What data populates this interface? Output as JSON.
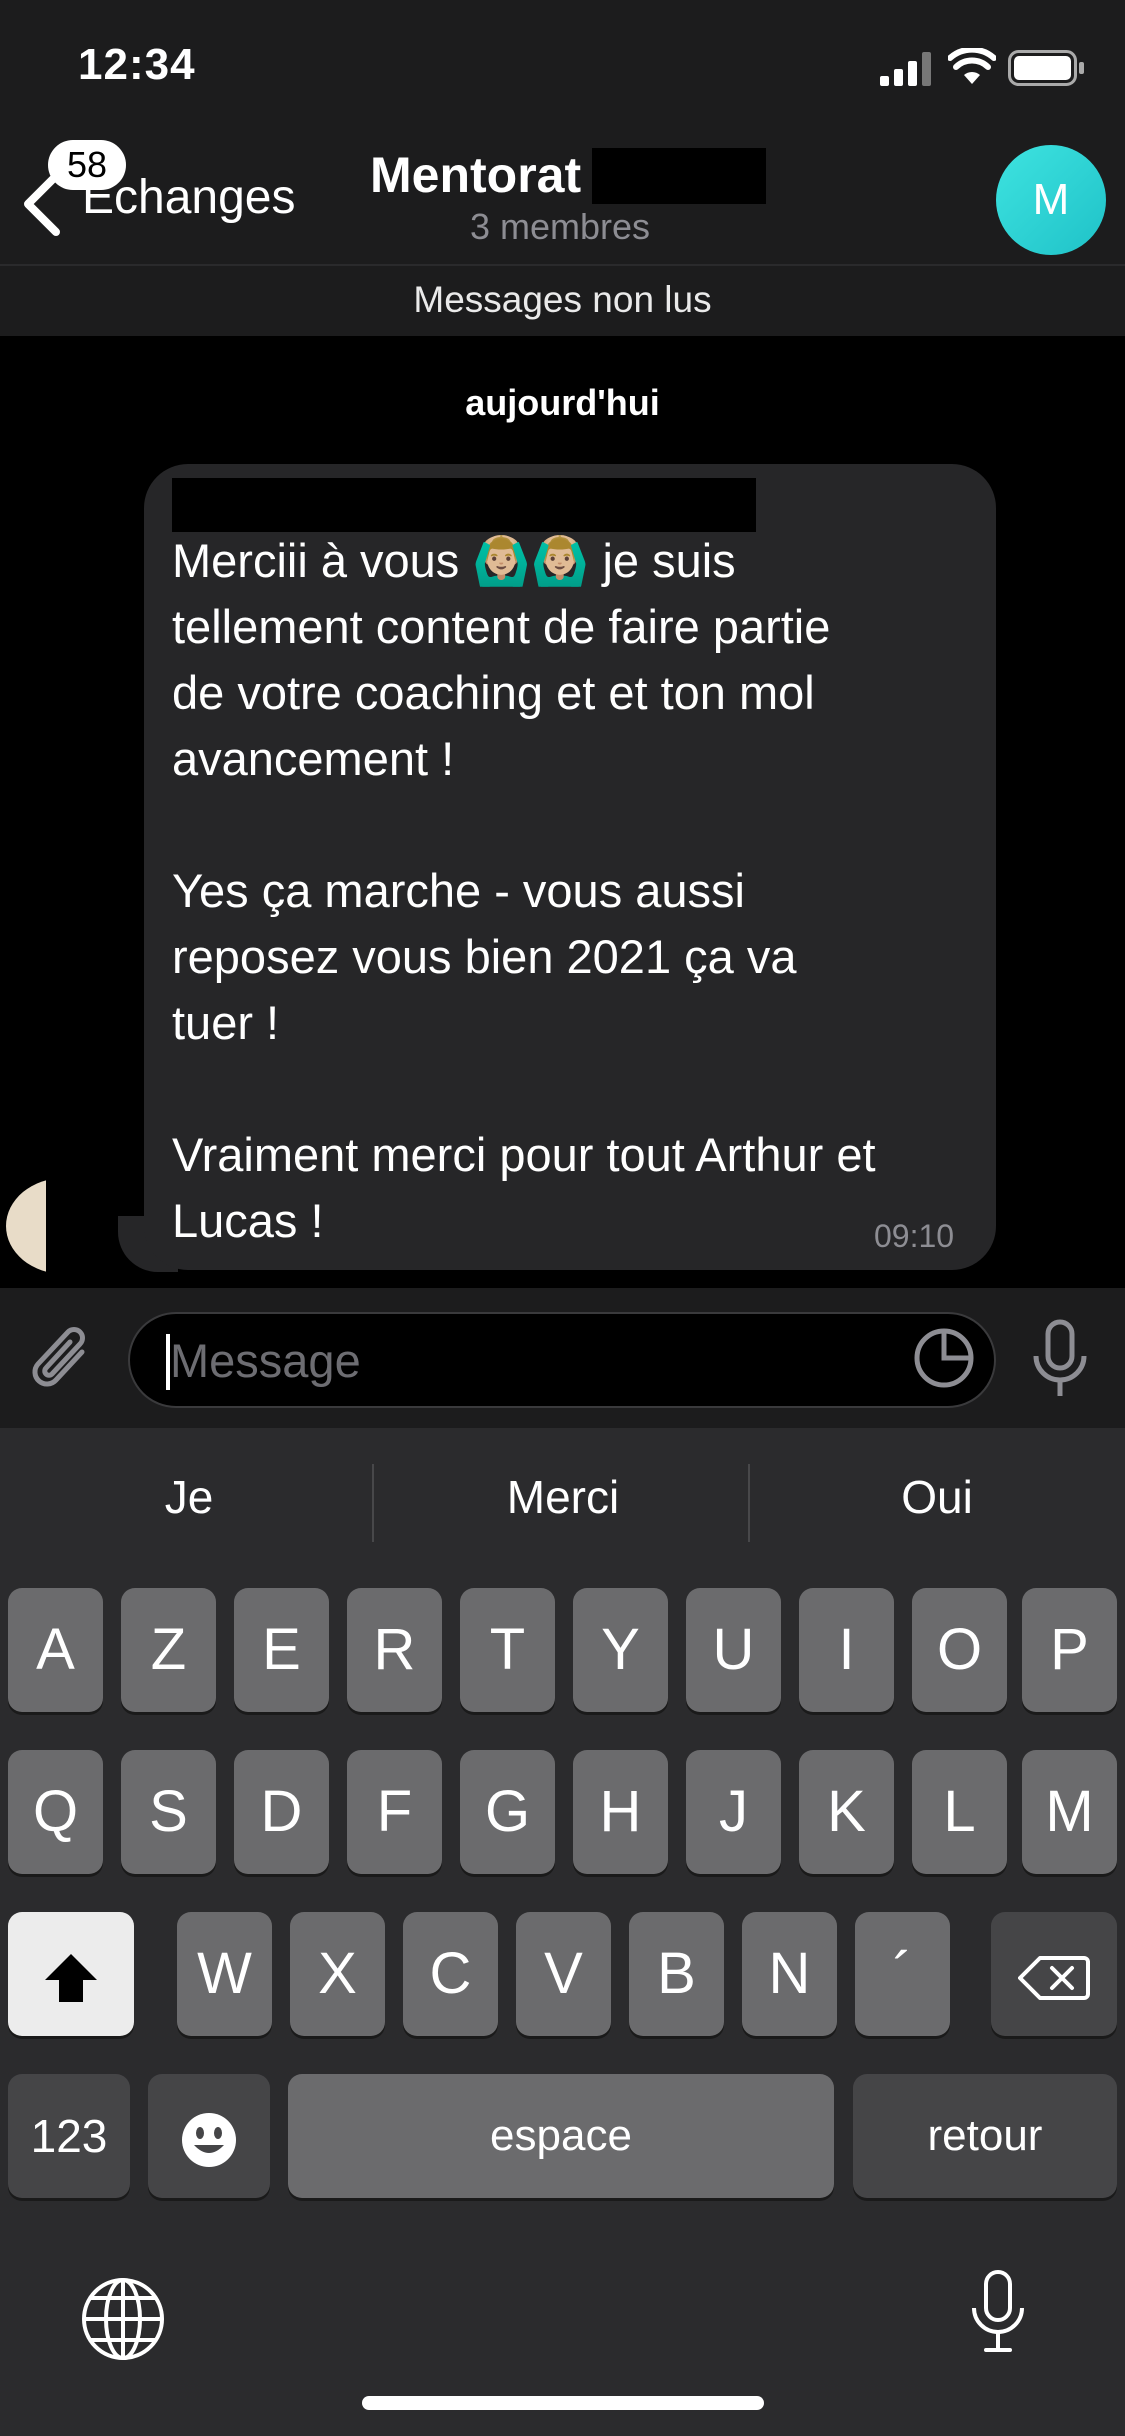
{
  "status_bar": {
    "time": "12:34"
  },
  "header": {
    "back_badge": "58",
    "back_label": "Échanges",
    "title": "Mentorat",
    "subtitle": "3 membres",
    "avatar_initial": "M"
  },
  "unread_banner": "Messages non lus",
  "date_separator": "aujourd'hui",
  "message": {
    "text": "Merciii à vous 🙆🏼‍♂️🙆🏼‍♂️ je suis\ntellement content de faire partie\nde votre coaching et et ton mol\navancement !\n\nYes ça marche - vous aussi\nreposez vous bien 2021 ça va\ntuer !\n\nVraiment merci pour tout Arthur et\nLucas !",
    "time": "09:10"
  },
  "composer": {
    "placeholder": "Message"
  },
  "keyboard": {
    "suggestions": [
      "Je",
      "Merci",
      "Oui"
    ],
    "row1": [
      "A",
      "Z",
      "E",
      "R",
      "T",
      "Y",
      "U",
      "I",
      "O",
      "P"
    ],
    "row2": [
      "Q",
      "S",
      "D",
      "F",
      "G",
      "H",
      "J",
      "K",
      "L",
      "M"
    ],
    "row3": [
      "W",
      "X",
      "C",
      "V",
      "B",
      "N",
      "´"
    ],
    "numbers_key": "123",
    "space_key": "espace",
    "return_key": "retour"
  },
  "colors": {
    "background": "#000000",
    "bar": "#1c1c1d",
    "bubble": "#262628",
    "avatar": "#2fd4d6",
    "key": "#6b6b6d",
    "key_fn": "#454547"
  }
}
